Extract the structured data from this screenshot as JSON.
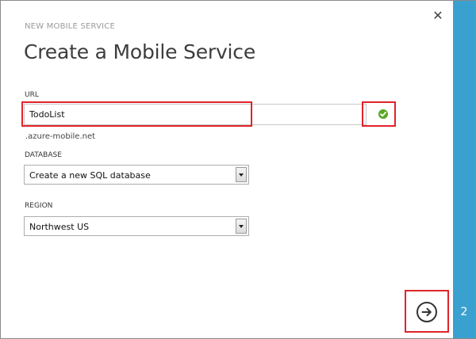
{
  "dialog": {
    "subtitle": "NEW MOBILE SERVICE",
    "title": "Create a Mobile Service",
    "close_icon": "close-icon",
    "step_number": "2",
    "next_icon": "arrow-right-circle-icon"
  },
  "url": {
    "label": "URL",
    "value": "TodoList",
    "suffix": ".azure-mobile.net",
    "status_icon": "checkmark-circle-icon"
  },
  "database": {
    "label": "DATABASE",
    "selected": "Create a new SQL database"
  },
  "region": {
    "label": "REGION",
    "selected": "Northwest US"
  },
  "colors": {
    "accent": "#3aa0cf",
    "highlight": "#e0232a",
    "valid": "#5aa827"
  }
}
